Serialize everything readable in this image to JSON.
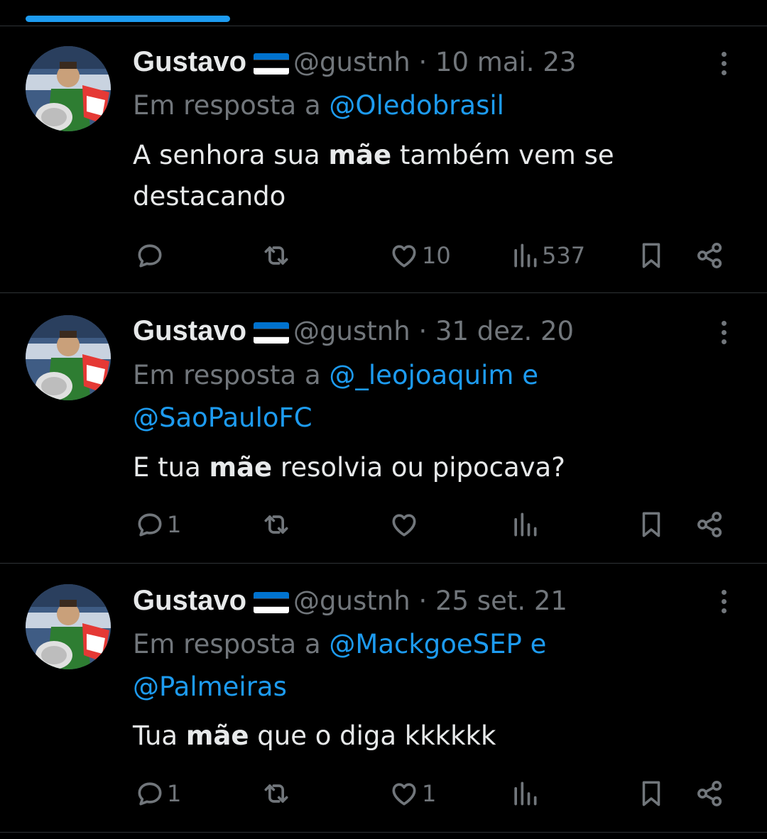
{
  "tweets": [
    {
      "name": "Gustavo",
      "handle": "@gustnh",
      "date": "· 10 mai. 23",
      "reply_prefix": "Em resposta a ",
      "reply_line1": "@Oledobrasil",
      "reply_line2": "",
      "text_before": "A senhora sua ",
      "text_bold": "mãe",
      "text_after": " também vem se destacando",
      "replies": "",
      "retweets": "",
      "likes": "10",
      "views": "537"
    },
    {
      "name": "Gustavo",
      "handle": "@gustnh",
      "date": "· 31 dez. 20",
      "reply_prefix": "Em resposta a ",
      "reply_line1": "@_leojoaquim e",
      "reply_line2": "@SaoPauloFC",
      "text_before": "E tua ",
      "text_bold": "mãe",
      "text_after": " resolvia ou pipocava?",
      "replies": "1",
      "retweets": "",
      "likes": "",
      "views": ""
    },
    {
      "name": "Gustavo",
      "handle": "@gustnh",
      "date": "· 25 set. 21",
      "reply_prefix": "Em resposta a ",
      "reply_line1": "@MackgoeSEP e",
      "reply_line2": "@Palmeiras",
      "text_before": "Tua ",
      "text_bold": "mãe",
      "text_after": " que o diga kkkkkk",
      "replies": "1",
      "retweets": "",
      "likes": "1",
      "views": ""
    }
  ],
  "icons": {
    "reply": "reply-icon",
    "retweet": "retweet-icon",
    "like": "heart-icon",
    "views": "views-icon",
    "bookmark": "bookmark-icon",
    "share": "share-icon",
    "more": "more-options-icon"
  },
  "colors": {
    "background": "#000000",
    "text": "#e7e9ea",
    "muted": "#71767b",
    "link": "#1d9bf0",
    "divider": "#2f3336",
    "flag_blue": "#0072ce",
    "flag_black": "#000000",
    "flag_white": "#ffffff"
  }
}
